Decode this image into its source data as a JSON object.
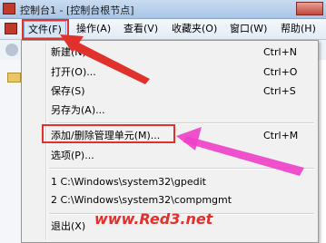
{
  "window": {
    "title": "控制台1 - [控制台根节点]"
  },
  "menubar": {
    "items": [
      {
        "label": "文件(F)"
      },
      {
        "label": "操作(A)"
      },
      {
        "label": "查看(V)"
      },
      {
        "label": "收藏夹(O)"
      },
      {
        "label": "窗口(W)"
      },
      {
        "label": "帮助(H)"
      }
    ]
  },
  "file_menu": {
    "items": [
      {
        "label": "新建(N)",
        "shortcut": "Ctrl+N"
      },
      {
        "label": "打开(O)...",
        "shortcut": "Ctrl+O"
      },
      {
        "label": "保存(S)",
        "shortcut": "Ctrl+S"
      },
      {
        "label": "另存为(A)...",
        "shortcut": ""
      },
      {
        "label": "添加/删除管理单元(M)...",
        "shortcut": "Ctrl+M"
      },
      {
        "label": "选项(P)...",
        "shortcut": ""
      },
      {
        "label": "1 C:\\Windows\\system32\\gpedit",
        "shortcut": ""
      },
      {
        "label": "2 C:\\Windows\\system32\\compmgmt",
        "shortcut": ""
      },
      {
        "label": "退出(X)",
        "shortcut": ""
      }
    ]
  },
  "watermark": {
    "text": "www.Red3.net"
  },
  "colors": {
    "annotation": "#e0312d",
    "arrow": "#ee3fc8"
  },
  "icons": [
    "app-icon",
    "back-icon",
    "folder-icon"
  ]
}
